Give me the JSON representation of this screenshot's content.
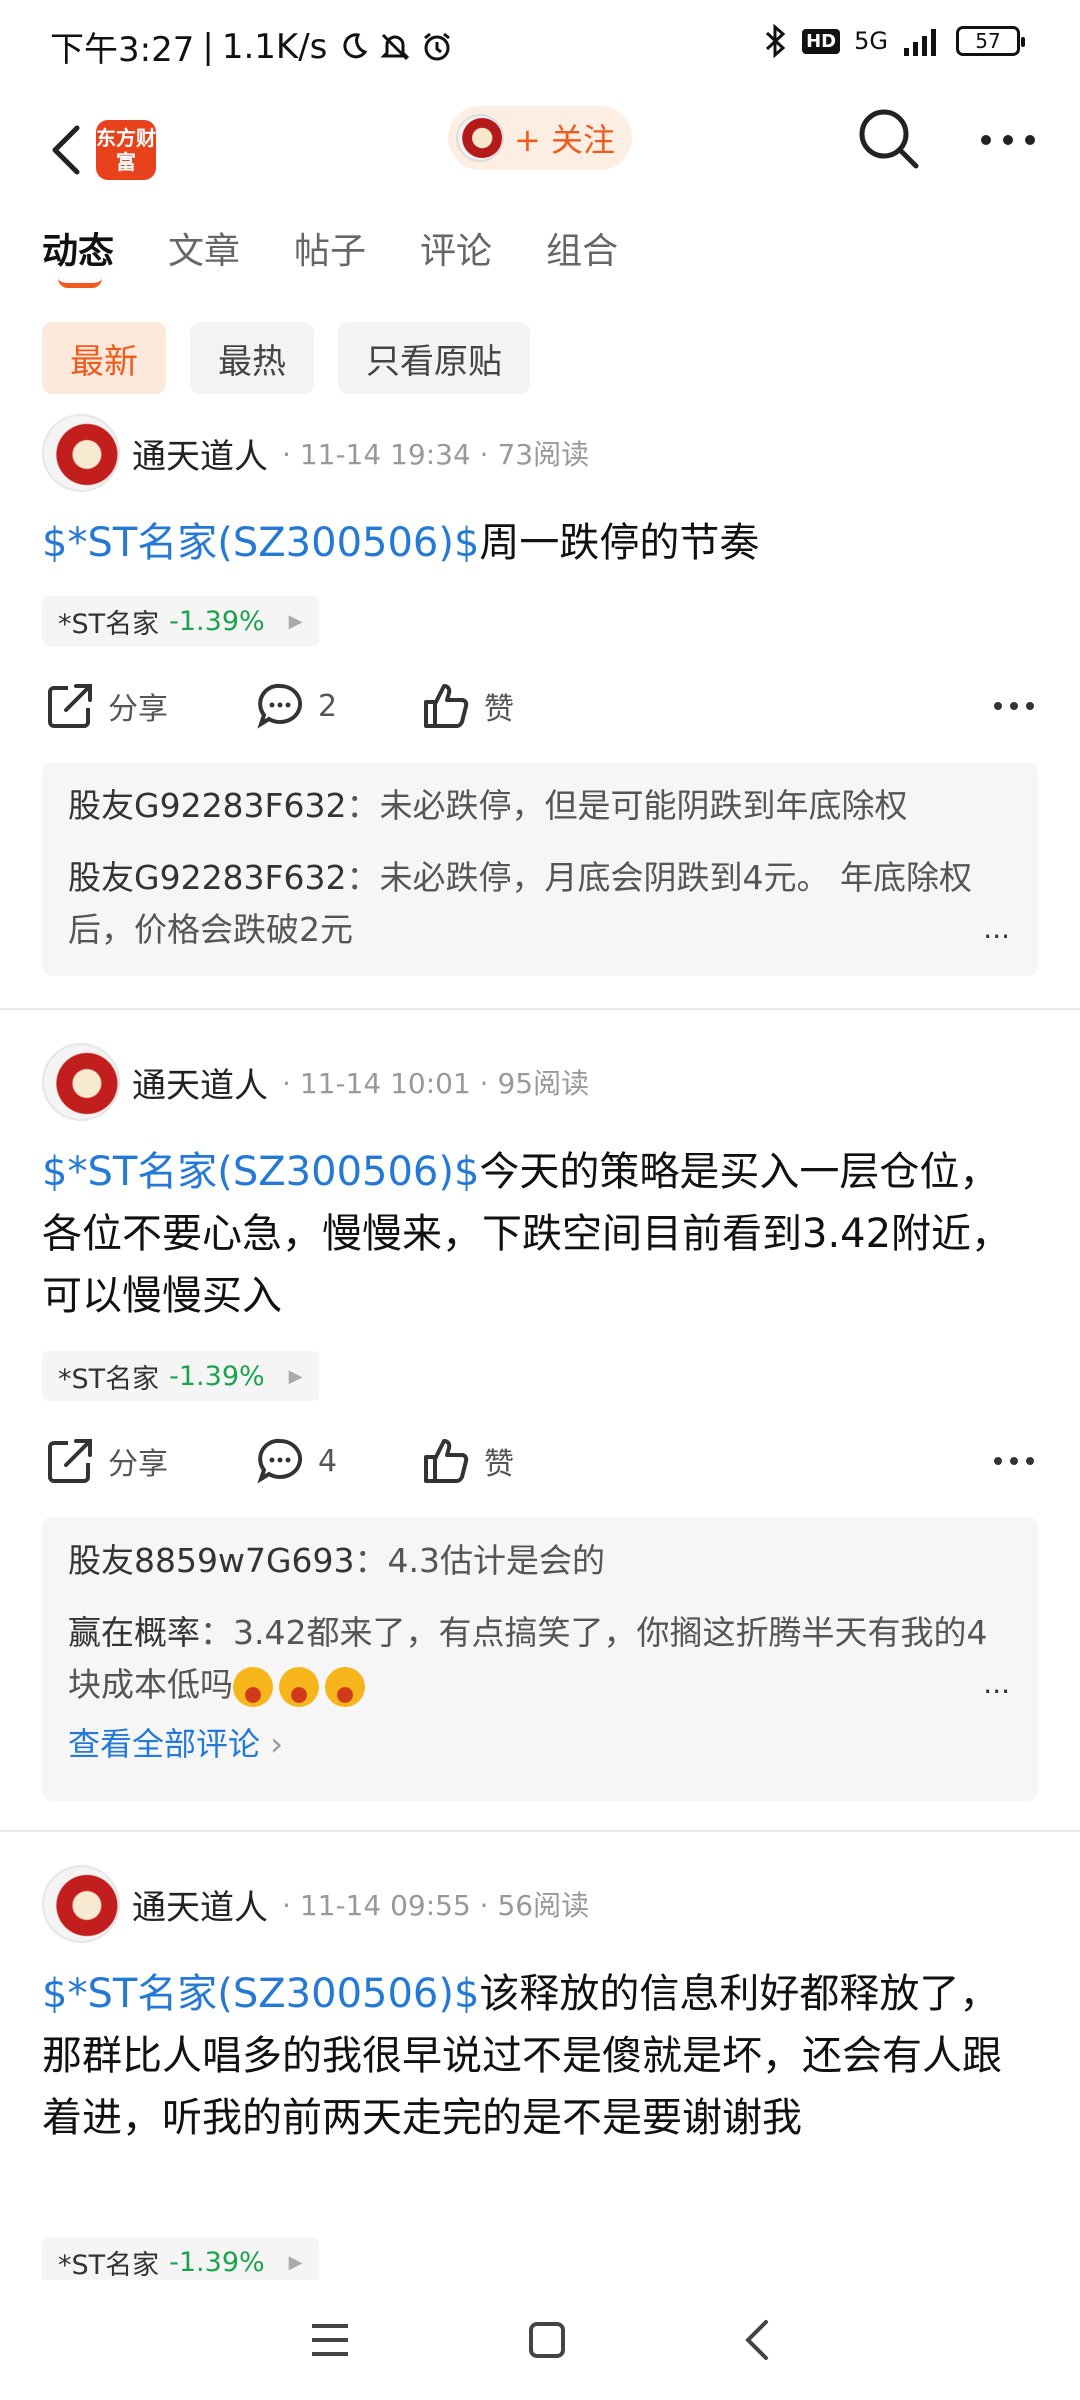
{
  "status_bar": {
    "time": "下午3:27",
    "network_speed": "1.1K/s",
    "network": "5G",
    "battery": "57"
  },
  "header": {
    "logo_text": "东方财富",
    "follow_label": "+ 关注"
  },
  "tabs": [
    {
      "label": "动态",
      "active": true
    },
    {
      "label": "文章"
    },
    {
      "label": "帖子"
    },
    {
      "label": "评论"
    },
    {
      "label": "组合"
    }
  ],
  "filters": [
    {
      "label": "最新",
      "active": true
    },
    {
      "label": "最热"
    },
    {
      "label": "只看原贴"
    }
  ],
  "posts": [
    {
      "author": "通天道人",
      "time": "11-14 19:34",
      "reads": "73阅读",
      "ticker": "$*ST名家(SZ300506)$",
      "text": "周一跌停的节奏",
      "tag_name": "*ST名家",
      "tag_change": "-1.39%",
      "share_label": "分享",
      "comment_count": "2",
      "like_label": "赞",
      "comments": [
        {
          "user": "股友G92283F632",
          "text": "：未必跌停，但是可能阴跌到年底除权"
        },
        {
          "user": "股友G92283F632",
          "text": "：未必跌停，月底会阴跌到4元。  年底除权后，价格会跌破2元"
        }
      ],
      "more_dots": "..."
    },
    {
      "author": "通天道人",
      "time": "11-14 10:01",
      "reads": "95阅读",
      "ticker": "$*ST名家(SZ300506)$",
      "text": "今天的策略是买入一层仓位，各位不要心急，慢慢来，下跌空间目前看到3.42附近，可以慢慢买入",
      "tag_name": "*ST名家",
      "tag_change": "-1.39%",
      "share_label": "分享",
      "comment_count": "4",
      "like_label": "赞",
      "comments": [
        {
          "user": "股友8859w7G693",
          "text": "：4.3估计是会的"
        },
        {
          "user": "赢在概率",
          "text": "：3.42都来了，有点搞笑了，你搁这折腾半天有我的4块成本低吗"
        }
      ],
      "more_dots": "...",
      "view_all": "查看全部评论"
    },
    {
      "author": "通天道人",
      "time": "11-14 09:55",
      "reads": "56阅读",
      "ticker": "$*ST名家(SZ300506)$",
      "text": "该释放的信息利好都释放了，那群比人唱多的我很早说过不是傻就是坏，还会有人跟着进，听我的前两天走完的是不是要谢谢我",
      "tag_name": "*ST名家",
      "tag_change": "-1.39%"
    }
  ],
  "colors": {
    "accent": "#f05a1a",
    "link": "#2579d6",
    "down": "#1aa34a"
  }
}
